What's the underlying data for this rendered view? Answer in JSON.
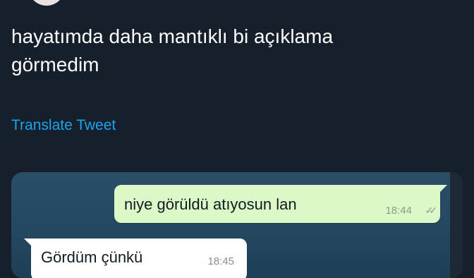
{
  "tweet": {
    "text": "hayatımda daha mantıklı bi açıklama\ngörmedim",
    "translate_label": "Translate Tweet"
  },
  "chat": {
    "messages": [
      {
        "direction": "outgoing",
        "text": "niye görüldü atıyosun lan",
        "time": "18:44",
        "status_icon": "double-check-icon"
      },
      {
        "direction": "incoming",
        "text": "Gördüm çünkü",
        "time": "18:45"
      }
    ]
  },
  "colors": {
    "background": "#15202b",
    "link": "#1da1f2",
    "outgoing_bubble": "#dcf8c6",
    "incoming_bubble": "#ffffff"
  }
}
